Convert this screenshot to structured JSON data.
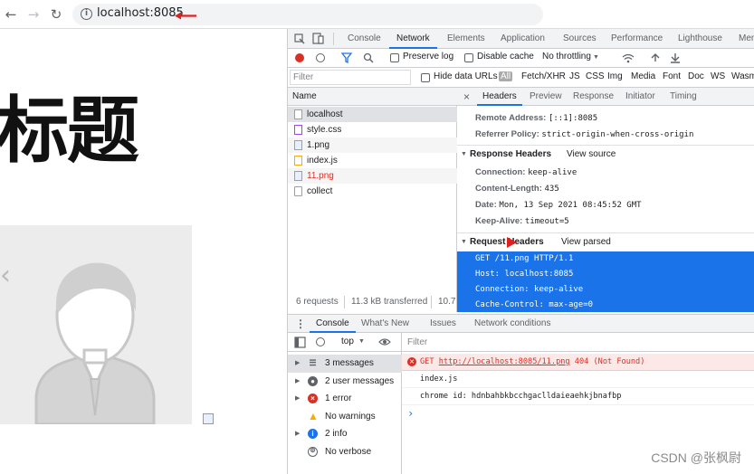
{
  "browser": {
    "url": "localhost:8085",
    "back_icon": "←",
    "forward_icon": "→",
    "reload_icon": "↻"
  },
  "page": {
    "title": "标题",
    "prev_arrow": "‹"
  },
  "devtools": {
    "tabs": [
      "Console",
      "Network",
      "Elements",
      "Application",
      "Sources",
      "Performance",
      "Lighthouse",
      "Mem"
    ],
    "active_tab": "Network",
    "toolbar": {
      "preserve_log": "Preserve log",
      "disable_cache": "Disable cache",
      "throttling": "No throttling"
    },
    "filter": {
      "placeholder": "Filter",
      "hide_data_urls": "Hide data URLs",
      "types": [
        "All",
        "Fetch/XHR",
        "JS",
        "CSS",
        "Img",
        "Media",
        "Font",
        "Doc",
        "WS",
        "Wasm"
      ]
    },
    "requests": {
      "header": "Name",
      "items": [
        {
          "name": "localhost",
          "color": "#202124"
        },
        {
          "name": "style.css",
          "color": "#202124"
        },
        {
          "name": "1.png",
          "color": "#202124"
        },
        {
          "name": "index.js",
          "color": "#202124"
        },
        {
          "name": "11.png",
          "color": "#d93025"
        },
        {
          "name": "collect",
          "color": "#202124"
        }
      ]
    },
    "detail_tabs": [
      "Headers",
      "Preview",
      "Response",
      "Initiator",
      "Timing"
    ],
    "close_icon": "×",
    "general": [
      {
        "k": "Remote Address:",
        "v": "[::1]:8085"
      },
      {
        "k": "Referrer Policy:",
        "v": "strict-origin-when-cross-origin"
      }
    ],
    "response_headers": {
      "title": "Response Headers",
      "link": "View source",
      "rows": [
        {
          "k": "Connection:",
          "v": "keep-alive"
        },
        {
          "k": "Content-Length:",
          "v": "435"
        },
        {
          "k": "Date:",
          "v": "Mon, 13 Sep 2021 08:45:52 GMT"
        },
        {
          "k": "Keep-Alive:",
          "v": "timeout=5"
        }
      ]
    },
    "request_headers": {
      "title": "Request Headers",
      "link": "View parsed",
      "lines": [
        "GET /11.png HTTP/1.1",
        "Host: localhost:8085",
        "Connection: keep-alive",
        "Cache-Control: max-age=0"
      ]
    },
    "status": {
      "requests": "6 requests",
      "transferred": "11.3 kB transferred",
      "extra": "10.7"
    },
    "drawer_tabs": [
      "Console",
      "What's New",
      "Issues",
      "Network conditions"
    ],
    "console_toolbar": {
      "context": "top",
      "filter_placeholder": "Filter"
    },
    "console_sidebar": [
      {
        "label": "3 messages",
        "icon": "list",
        "color": "#5f6368"
      },
      {
        "label": "2 user messages",
        "icon": "user",
        "color": "#5f6368"
      },
      {
        "label": "1 error",
        "icon": "error",
        "color": "#d93025"
      },
      {
        "label": "No warnings",
        "icon": "warning",
        "color": "#f9ab00"
      },
      {
        "label": "2 info",
        "icon": "info",
        "color": "#1a73e8"
      },
      {
        "label": "No verbose",
        "icon": "verbose",
        "color": "#5f6368"
      }
    ],
    "console_log": {
      "error_method": "GET",
      "error_url": "http://localhost:8085/11.png",
      "error_status": "404 (Not Found)",
      "line2": "index.js",
      "line3": "chrome id: hdnbahbkbcchgaclldaieaehkjbnafbp",
      "prompt": "›"
    }
  },
  "watermark": "CSDN @张枫尉"
}
